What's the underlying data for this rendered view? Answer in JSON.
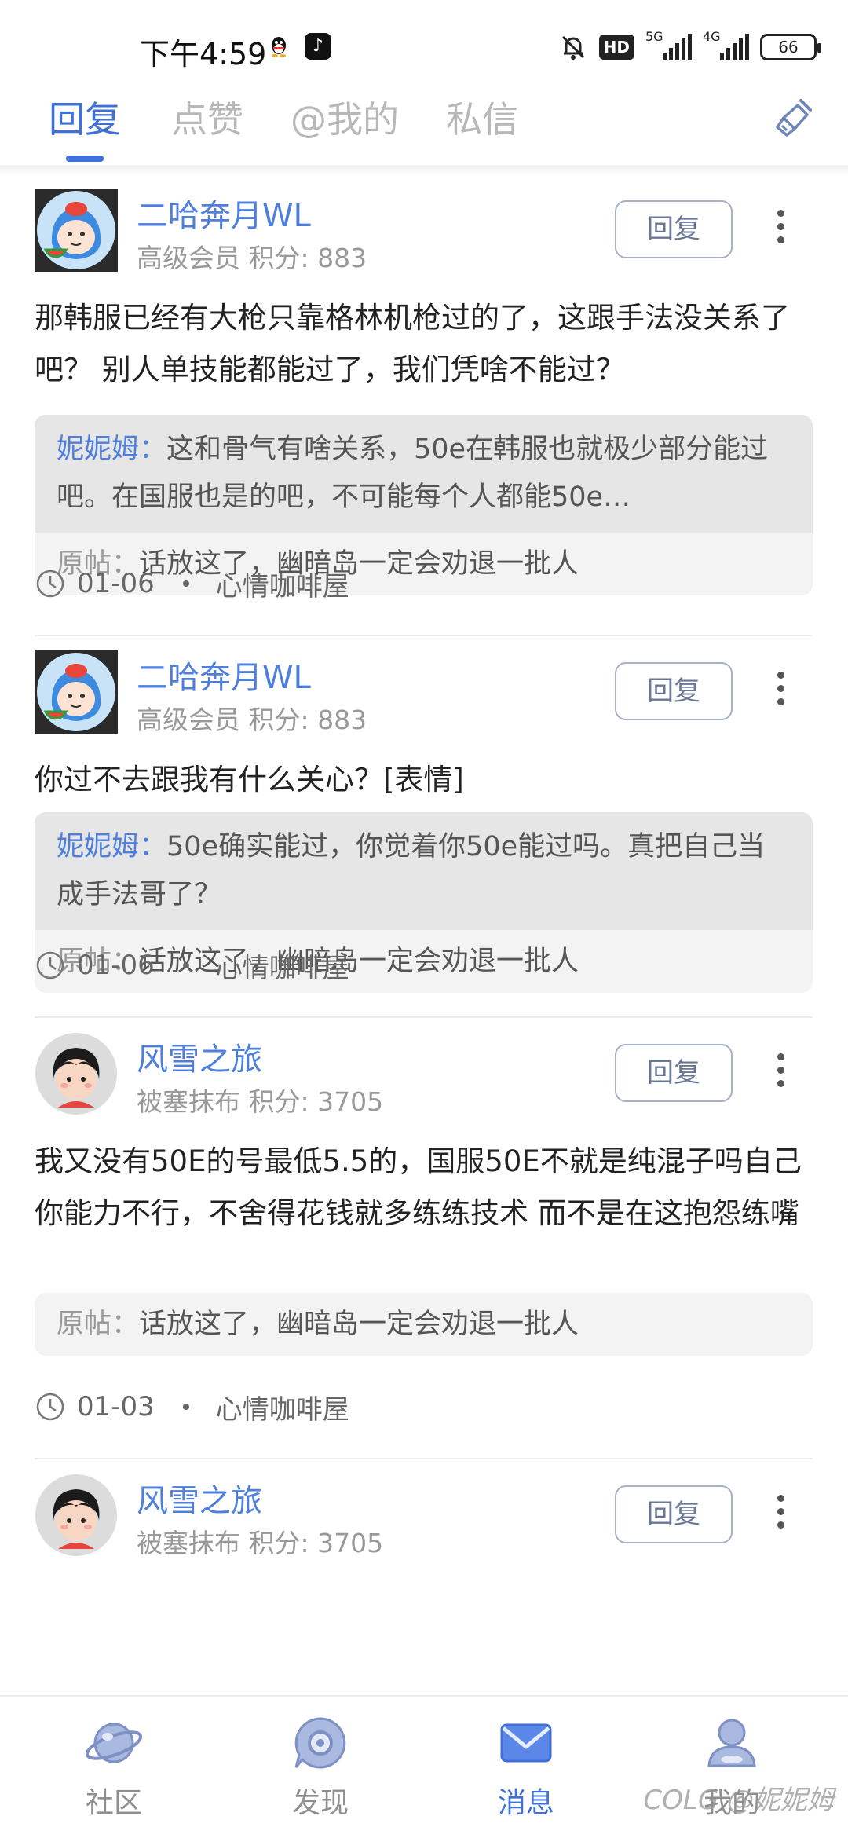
{
  "status_bar": {
    "time": "下午4:59",
    "hd_label": "HD",
    "net1": "5G",
    "net2": "4G",
    "battery": "66"
  },
  "tabs": [
    {
      "label": "回复",
      "active": true
    },
    {
      "label": "点赞",
      "active": false
    },
    {
      "label": "@我的",
      "active": false
    },
    {
      "label": "私信",
      "active": false
    }
  ],
  "feed": [
    {
      "username": "二哈奔月WL",
      "member_level": "高级会员",
      "points": "积分: 883",
      "reply_label": "回复",
      "content": "那韩服已经有大枪只靠格林机枪过的了，这跟手法没关系了吧？ 别人单技能都能过了，我们凭啥不能过？",
      "quote_name": "妮妮姆：",
      "quote_text": "这和骨气有啥关系，50e在韩服也就极少部分能过吧。在国服也是的吧，不可能每个人都能50e…",
      "orig_label": "原帖：",
      "orig_text": "话放这了，幽暗岛一定会劝退一批人",
      "date": "01-06",
      "board": "心情咖啡屋"
    },
    {
      "username": "二哈奔月WL",
      "member_level": "高级会员",
      "points": "积分: 883",
      "reply_label": "回复",
      "content": "你过不去跟我有什么关心？[表情]",
      "quote_name": "妮妮姆：",
      "quote_text": "50e确实能过，你觉着你50e能过吗。真把自己当成手法哥了？",
      "orig_label": "原帖：",
      "orig_text": "话放这了，幽暗岛一定会劝退一批人",
      "date": "01-06",
      "board": "心情咖啡屋"
    },
    {
      "username": "风雪之旅",
      "member_level": "被塞抹布",
      "points": "积分: 3705",
      "reply_label": "回复",
      "content": "我又没有50E的号最低5.5的，国服50E不就是纯混子吗自己你能力不行，不舍得花钱就多练练技术 而不是在这抱怨练嘴",
      "orig_label": "原帖：",
      "orig_text": "话放这了，幽暗岛一定会劝退一批人",
      "date": "01-03",
      "board": "心情咖啡屋"
    },
    {
      "username": "风雪之旅",
      "member_level": "被塞抹布",
      "points": "积分: 3705",
      "reply_label": "回复"
    }
  ],
  "bottom_nav": [
    {
      "label": "社区",
      "icon": "planet-icon",
      "active": false
    },
    {
      "label": "发现",
      "icon": "discover-icon",
      "active": false
    },
    {
      "label": "消息",
      "icon": "mail-icon",
      "active": true
    },
    {
      "label": "我的",
      "icon": "profile-icon",
      "active": false
    }
  ],
  "watermark": "COLG @妮妮姆",
  "colors": {
    "accent": "#3f6fd8",
    "username": "#4f7fdc",
    "muted": "#999999",
    "quote_bg": "#e6e6e6",
    "orig_bg": "#f3f3f3"
  }
}
